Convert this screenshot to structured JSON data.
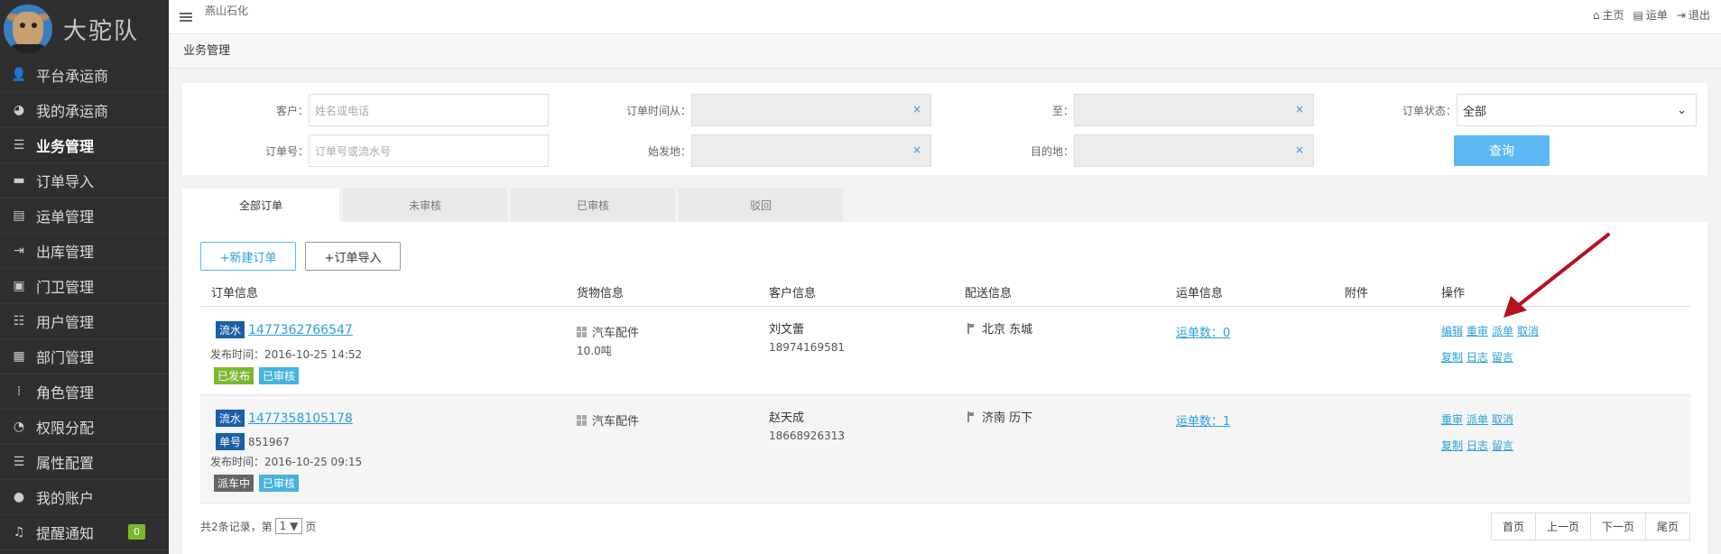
{
  "brand": {
    "name": "大驼队"
  },
  "sidebar": {
    "items": [
      {
        "label": "平台承运商",
        "icon": "user-icon"
      },
      {
        "label": "我的承运商",
        "icon": "pie-icon"
      },
      {
        "label": "业务管理",
        "icon": "list-icon",
        "active": true
      },
      {
        "label": "订单导入",
        "icon": "folder-icon"
      },
      {
        "label": "运单管理",
        "icon": "document-icon"
      },
      {
        "label": "出库管理",
        "icon": "exit-icon"
      },
      {
        "label": "门卫管理",
        "icon": "briefcase-icon"
      },
      {
        "label": "用户管理",
        "icon": "user-list-icon"
      },
      {
        "label": "部门管理",
        "icon": "grid-icon"
      },
      {
        "label": "角色管理",
        "icon": "dots-grid-icon"
      },
      {
        "label": "权限分配",
        "icon": "dashboard-icon"
      },
      {
        "label": "属性配置",
        "icon": "list-icon"
      },
      {
        "label": "我的账户",
        "icon": "account-icon"
      },
      {
        "label": "提醒通知",
        "icon": "bell-icon",
        "badge": "0"
      }
    ]
  },
  "topbar": {
    "company": "燕山石化",
    "links": {
      "home": "主页",
      "waybill": "运单",
      "logout": "退出"
    }
  },
  "breadcrumb": "业务管理",
  "filter": {
    "customer_label": "客户：",
    "customer_placeholder": "姓名或电话",
    "order_time_from_label": "订单时间从：",
    "to_label": "至：",
    "order_status_label": "订单状态：",
    "order_status_value": "全部",
    "order_no_label": "订单号：",
    "order_no_placeholder": "订单号或流水号",
    "origin_label": "始发地：",
    "destination_label": "目的地：",
    "clear_symbol": "×",
    "query_button": "查询"
  },
  "tabs": [
    "全部订单",
    "未审核",
    "已审核",
    "驳回"
  ],
  "actions": {
    "new_order": "+新建订单",
    "import_order": "+订单导入"
  },
  "table": {
    "headers": [
      "订单信息",
      "货物信息",
      "客户信息",
      "配送信息",
      "运单信息",
      "附件",
      "操作"
    ],
    "rows": [
      {
        "serial_tag": "流水",
        "serial_no": "1477362766547",
        "publish_time": "发布时间：2016-10-25 14:52",
        "status_tags": [
          "已发布",
          "已审核"
        ],
        "goods": "汽车配件",
        "weight": "10.0吨",
        "customer_name": "刘文蕾",
        "customer_phone": "18974169581",
        "destination": "北京 东城",
        "waybill": "运单数：0",
        "ops_line1": [
          "编辑",
          "重审",
          "派单",
          "取消"
        ],
        "ops_line2": [
          "复制",
          "日志",
          "留言"
        ]
      },
      {
        "serial_tag": "流水",
        "serial_no": "1477358105178",
        "number_tag": "单号",
        "number": "851967",
        "publish_time": "发布时间：2016-10-25 09:15",
        "status_tags": [
          "派车中",
          "已审核"
        ],
        "goods": "汽车配件",
        "customer_name": "赵天成",
        "customer_phone": "18668926313",
        "destination": "济南 历下",
        "waybill": "运单数：1",
        "ops_line1": [
          "重审",
          "派单",
          "取消"
        ],
        "ops_line2": [
          "复制",
          "日志",
          "留言"
        ]
      }
    ]
  },
  "pagination": {
    "summary_prefix": "共2条记录，第",
    "page_value": "1 ▼",
    "summary_suffix": "页",
    "buttons": [
      "首页",
      "上一页",
      "下一页",
      "尾页"
    ]
  },
  "colors": {
    "accent": "#5bb8f2",
    "sidebar": "#2f2f2f",
    "annotation_arrow": "#b5121b"
  }
}
